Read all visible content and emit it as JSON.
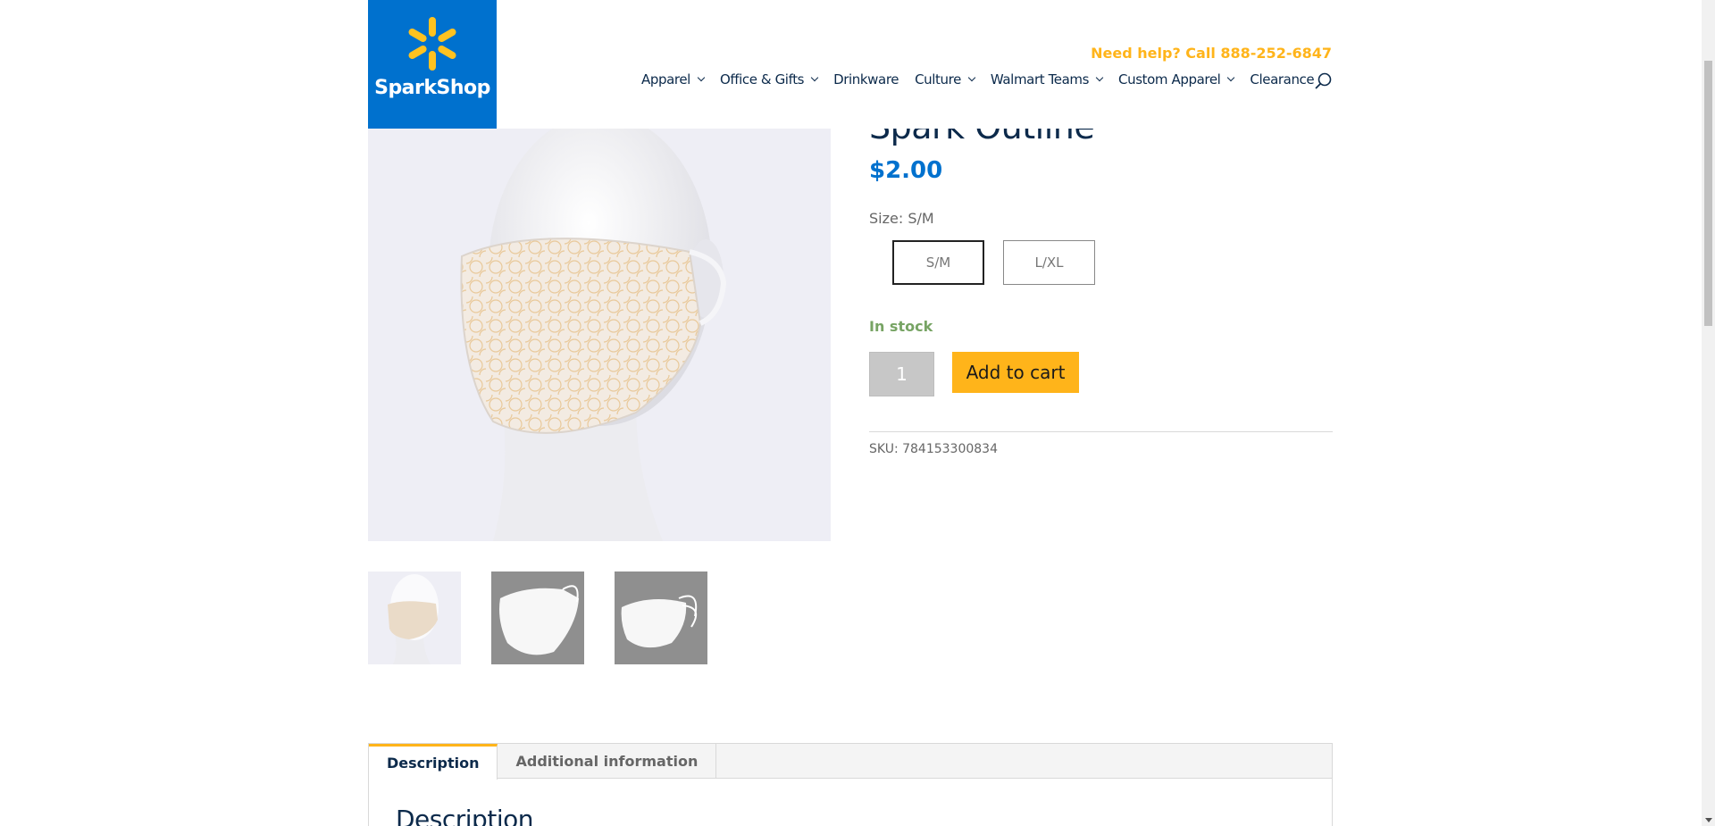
{
  "brand": {
    "name": "SparkShop",
    "logo_color": "#0071ce",
    "spark_color": "#ffc220"
  },
  "header": {
    "help_text": "Need help? Call 888-252-6847",
    "nav": [
      {
        "label": "Apparel",
        "has_dropdown": true
      },
      {
        "label": "Office & Gifts",
        "has_dropdown": true
      },
      {
        "label": "Drinkware",
        "has_dropdown": false
      },
      {
        "label": "Culture",
        "has_dropdown": true
      },
      {
        "label": "Walmart Teams",
        "has_dropdown": true
      },
      {
        "label": "Custom Apparel",
        "has_dropdown": true
      },
      {
        "label": "Clearance",
        "has_dropdown": false
      }
    ],
    "search_icon": "search-icon"
  },
  "product": {
    "title": "Spark Outline",
    "price": "$2.00",
    "size_label": "Size: S/M",
    "sizes": [
      {
        "label": "S/M",
        "selected": true
      },
      {
        "label": "L/XL",
        "selected": false
      }
    ],
    "stock": "In stock",
    "quantity": "1",
    "add_to_cart": "Add to cart",
    "sku": "SKU: 784153300834"
  },
  "tabs": {
    "items": [
      {
        "label": "Description",
        "active": true
      },
      {
        "label": "Additional information",
        "active": false
      }
    ],
    "content_heading": "Description"
  },
  "colors": {
    "accent": "#ffb41a",
    "price": "#0071ce",
    "stock": "#77a464",
    "heading": "#0c2a4b"
  }
}
